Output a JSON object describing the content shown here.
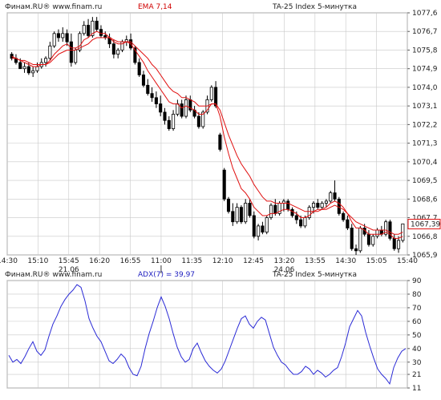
{
  "main_panel": {
    "header_left": "Финам.RU® www.finam.ru",
    "header_indicator": "EMA 7,14",
    "header_right": "TA-25 Index 5-минутка",
    "last_price_label": "1067,39"
  },
  "adx_panel": {
    "header_left": "Финам.RU® www.finam.ru",
    "header_indicator": "ADX(7) = 39,97",
    "header_right": "TA-25 Index 5-минутка"
  },
  "time_axis": {
    "ticks": [
      "14:30",
      "15:10",
      "15:45",
      "16:20",
      "16:55",
      "11:00",
      "11:35",
      "12:10",
      "12:45",
      "13:20",
      "13:55",
      "14:30",
      "15:05",
      "15:40"
    ],
    "date_labels": [
      {
        "label": "21.06",
        "at_tick": 2
      },
      {
        "label": "24.06",
        "at_tick": 9
      }
    ],
    "session_break_at_tick": 5
  },
  "colors": {
    "bull_candle": "#ffffff",
    "bear_candle": "#000000",
    "ema": "#e01010",
    "adx": "#2b2bd6",
    "grid": "#c8c8c8",
    "indicator_label": "#d00000",
    "adx_label": "#2020c0"
  },
  "chart_data": [
    {
      "type": "candlestick",
      "title": "TA-25 Index 5-минутка",
      "indicator": "EMA 7,14",
      "y_axis_ticks": [
        "1077,6",
        "1076,7",
        "1075,8",
        "1074,9",
        "1074,0",
        "1073,1",
        "1072,2",
        "1071,3",
        "1070,4",
        "1069,5",
        "1068,6",
        "1067,7",
        "1066,8",
        "1065,9"
      ],
      "ylim": [
        1065.9,
        1077.6
      ],
      "grid": true,
      "last_price": 1067.39,
      "candles": [
        [
          1075.6,
          1075.7,
          1075.3,
          1075.4
        ],
        [
          1075.4,
          1075.6,
          1075.1,
          1075.2
        ],
        [
          1075.2,
          1075.4,
          1074.9,
          1074.9
        ],
        [
          1074.9,
          1075.2,
          1074.7,
          1075.0
        ],
        [
          1075.0,
          1075.2,
          1074.6,
          1074.7
        ],
        [
          1074.7,
          1075.0,
          1074.5,
          1074.8
        ],
        [
          1074.8,
          1075.2,
          1074.7,
          1075.0
        ],
        [
          1075.0,
          1075.4,
          1074.9,
          1075.2
        ],
        [
          1075.2,
          1075.5,
          1075.0,
          1075.4
        ],
        [
          1075.4,
          1076.2,
          1075.3,
          1076.0
        ],
        [
          1076.0,
          1076.7,
          1075.9,
          1076.6
        ],
        [
          1076.6,
          1076.8,
          1076.2,
          1076.4
        ],
        [
          1076.4,
          1076.9,
          1076.2,
          1076.6
        ],
        [
          1076.6,
          1076.8,
          1076.0,
          1076.2
        ],
        [
          1076.2,
          1076.6,
          1075.0,
          1075.2
        ],
        [
          1075.2,
          1075.9,
          1075.1,
          1075.8
        ],
        [
          1075.8,
          1076.7,
          1075.7,
          1076.6
        ],
        [
          1076.6,
          1077.2,
          1076.5,
          1077.0
        ],
        [
          1077.0,
          1077.3,
          1076.4,
          1076.5
        ],
        [
          1076.5,
          1077.4,
          1076.4,
          1077.2
        ],
        [
          1077.2,
          1077.4,
          1076.7,
          1076.8
        ],
        [
          1076.8,
          1077.0,
          1076.4,
          1076.5
        ],
        [
          1076.5,
          1076.7,
          1076.3,
          1076.4
        ],
        [
          1076.4,
          1076.6,
          1075.9,
          1076.1
        ],
        [
          1076.1,
          1076.3,
          1075.4,
          1075.6
        ],
        [
          1075.6,
          1075.9,
          1075.4,
          1075.8
        ],
        [
          1075.8,
          1076.3,
          1075.7,
          1076.2
        ],
        [
          1076.2,
          1076.5,
          1076.0,
          1076.3
        ],
        [
          1076.3,
          1076.6,
          1075.8,
          1075.9
        ],
        [
          1075.9,
          1076.0,
          1075.1,
          1075.2
        ],
        [
          1075.2,
          1075.4,
          1074.5,
          1074.6
        ],
        [
          1074.6,
          1074.8,
          1074.0,
          1074.1
        ],
        [
          1074.1,
          1074.4,
          1073.6,
          1073.7
        ],
        [
          1073.7,
          1074.0,
          1073.3,
          1073.5
        ],
        [
          1073.5,
          1073.8,
          1073.0,
          1073.2
        ],
        [
          1073.2,
          1073.6,
          1072.6,
          1072.8
        ],
        [
          1072.8,
          1073.0,
          1072.2,
          1072.4
        ],
        [
          1072.4,
          1072.6,
          1071.9,
          1072.0
        ],
        [
          1072.0,
          1072.9,
          1071.9,
          1072.7
        ],
        [
          1072.7,
          1073.4,
          1072.6,
          1073.2
        ],
        [
          1073.2,
          1073.4,
          1072.5,
          1072.6
        ],
        [
          1072.6,
          1073.6,
          1072.5,
          1073.4
        ],
        [
          1073.4,
          1073.6,
          1072.8,
          1072.9
        ],
        [
          1072.9,
          1073.1,
          1072.5,
          1072.6
        ],
        [
          1072.6,
          1072.8,
          1072.0,
          1072.1
        ],
        [
          1072.1,
          1072.9,
          1072.0,
          1072.8
        ],
        [
          1072.8,
          1073.6,
          1072.7,
          1073.4
        ],
        [
          1073.4,
          1074.1,
          1073.3,
          1074.0
        ],
        [
          1074.0,
          1074.3,
          1073.0,
          1073.1
        ],
        [
          1071.7,
          1071.8,
          1070.9,
          1071.0
        ],
        [
          1070.0,
          1070.1,
          1068.5,
          1068.6
        ],
        [
          1068.6,
          1068.7,
          1067.9,
          1068.0
        ],
        [
          1068.0,
          1068.4,
          1067.3,
          1067.5
        ],
        [
          1067.5,
          1068.4,
          1067.4,
          1068.2
        ],
        [
          1068.2,
          1068.3,
          1067.4,
          1067.5
        ],
        [
          1067.5,
          1068.6,
          1067.4,
          1068.4
        ],
        [
          1068.4,
          1068.6,
          1067.7,
          1067.8
        ],
        [
          1067.8,
          1068.0,
          1066.7,
          1066.8
        ],
        [
          1066.8,
          1067.4,
          1066.6,
          1067.3
        ],
        [
          1067.3,
          1067.5,
          1066.9,
          1067.0
        ],
        [
          1067.0,
          1067.8,
          1066.9,
          1067.7
        ],
        [
          1067.7,
          1068.4,
          1067.6,
          1068.3
        ],
        [
          1068.3,
          1068.6,
          1067.8,
          1067.9
        ],
        [
          1067.9,
          1068.5,
          1067.8,
          1068.4
        ],
        [
          1068.4,
          1068.6,
          1068.0,
          1068.5
        ],
        [
          1068.5,
          1068.6,
          1068.0,
          1068.1
        ],
        [
          1068.1,
          1068.2,
          1067.7,
          1067.8
        ],
        [
          1067.8,
          1068.0,
          1067.4,
          1067.6
        ],
        [
          1067.6,
          1067.8,
          1067.2,
          1067.3
        ],
        [
          1067.3,
          1067.8,
          1067.2,
          1067.7
        ],
        [
          1067.7,
          1068.3,
          1067.6,
          1068.2
        ],
        [
          1068.2,
          1068.5,
          1067.9,
          1068.4
        ],
        [
          1068.4,
          1068.6,
          1068.1,
          1068.2
        ],
        [
          1068.2,
          1068.5,
          1068.1,
          1068.4
        ],
        [
          1068.4,
          1068.6,
          1068.2,
          1068.5
        ],
        [
          1068.5,
          1069.0,
          1068.4,
          1068.9
        ],
        [
          1068.9,
          1069.5,
          1068.5,
          1068.6
        ],
        [
          1068.6,
          1068.7,
          1067.8,
          1067.9
        ],
        [
          1067.9,
          1068.0,
          1067.5,
          1067.6
        ],
        [
          1067.6,
          1067.8,
          1067.1,
          1067.2
        ],
        [
          1067.2,
          1067.4,
          1066.1,
          1066.2
        ],
        [
          1066.2,
          1066.4,
          1065.9,
          1066.1
        ],
        [
          1066.1,
          1067.3,
          1066.0,
          1067.2
        ],
        [
          1067.2,
          1067.4,
          1066.8,
          1066.9
        ],
        [
          1066.9,
          1067.1,
          1066.3,
          1066.4
        ],
        [
          1066.4,
          1066.9,
          1066.3,
          1066.8
        ],
        [
          1066.8,
          1067.2,
          1066.7,
          1067.1
        ],
        [
          1067.1,
          1067.3,
          1066.8,
          1066.9
        ],
        [
          1066.9,
          1067.6,
          1066.8,
          1067.5
        ],
        [
          1067.5,
          1067.6,
          1066.6,
          1066.7
        ],
        [
          1066.7,
          1066.9,
          1066.1,
          1066.2
        ],
        [
          1066.2,
          1066.8,
          1066.0,
          1066.6
        ],
        [
          1066.6,
          1067.4,
          1066.5,
          1067.4
        ]
      ],
      "ema_fast": [
        1075.5,
        1075.4,
        1075.3,
        1075.2,
        1075.1,
        1075.0,
        1075.0,
        1075.1,
        1075.1,
        1075.3,
        1075.6,
        1075.8,
        1076.0,
        1076.1,
        1075.9,
        1075.9,
        1076.0,
        1076.3,
        1076.4,
        1076.6,
        1076.7,
        1076.6,
        1076.6,
        1076.4,
        1076.2,
        1076.1,
        1076.1,
        1076.2,
        1076.1,
        1075.8,
        1075.5,
        1075.2,
        1074.8,
        1074.5,
        1074.2,
        1073.9,
        1073.6,
        1073.3,
        1073.2,
        1073.2,
        1073.0,
        1073.1,
        1073.0,
        1072.9,
        1072.7,
        1072.7,
        1072.9,
        1073.2,
        1073.2,
        1072.6,
        1071.6,
        1070.8,
        1070.1,
        1069.6,
        1069.1,
        1068.9,
        1068.6,
        1068.2,
        1068.0,
        1067.8,
        1067.8,
        1067.9,
        1067.9,
        1068.0,
        1068.1,
        1068.1,
        1068.0,
        1067.9,
        1067.7,
        1067.7,
        1067.8,
        1068.0,
        1068.0,
        1068.1,
        1068.2,
        1068.4,
        1068.5,
        1068.4,
        1068.2,
        1067.9,
        1067.5,
        1067.2,
        1067.2,
        1067.1,
        1066.9,
        1066.9,
        1066.9,
        1066.9,
        1067.0,
        1066.9,
        1066.7,
        1066.7,
        1066.8
      ],
      "ema_slow": [
        1075.4,
        1075.4,
        1075.3,
        1075.3,
        1075.2,
        1075.1,
        1075.1,
        1075.1,
        1075.1,
        1075.2,
        1075.4,
        1075.6,
        1075.7,
        1075.8,
        1075.8,
        1075.8,
        1075.9,
        1076.0,
        1076.1,
        1076.3,
        1076.4,
        1076.4,
        1076.4,
        1076.4,
        1076.3,
        1076.2,
        1076.2,
        1076.2,
        1076.2,
        1076.0,
        1075.8,
        1075.6,
        1075.4,
        1075.1,
        1074.9,
        1074.6,
        1074.3,
        1074.0,
        1073.8,
        1073.7,
        1073.5,
        1073.5,
        1073.4,
        1073.3,
        1073.1,
        1073.1,
        1073.1,
        1073.2,
        1073.2,
        1072.9,
        1072.3,
        1071.7,
        1071.2,
        1070.7,
        1070.3,
        1070.0,
        1069.7,
        1069.3,
        1069.0,
        1068.7,
        1068.5,
        1068.5,
        1068.4,
        1068.4,
        1068.4,
        1068.4,
        1068.3,
        1068.2,
        1068.1,
        1068.0,
        1068.0,
        1068.0,
        1068.1,
        1068.1,
        1068.1,
        1068.2,
        1068.3,
        1068.2,
        1068.1,
        1067.9,
        1067.7,
        1067.5,
        1067.4,
        1067.3,
        1067.2,
        1067.1,
        1067.1,
        1067.1,
        1067.1,
        1067.0,
        1066.9,
        1066.9,
        1067.0
      ]
    },
    {
      "type": "line",
      "title": "TA-25 Index 5-минутка",
      "indicator": "ADX(7)",
      "last_value": 39.97,
      "y_axis_ticks": [
        "90",
        "80",
        "70",
        "60",
        "50",
        "40",
        "30",
        "21",
        "11"
      ],
      "ylim": [
        11,
        90
      ],
      "grid": true,
      "series": [
        {
          "name": "ADX(7)",
          "values": [
            35,
            30,
            32,
            29,
            34,
            40,
            45,
            38,
            35,
            39,
            49,
            58,
            64,
            71,
            76,
            80,
            83,
            87,
            85,
            75,
            62,
            55,
            49,
            45,
            38,
            31,
            29,
            32,
            36,
            33,
            26,
            21,
            20,
            27,
            40,
            51,
            60,
            70,
            78,
            71,
            62,
            51,
            41,
            34,
            30,
            32,
            40,
            44,
            37,
            31,
            27,
            24,
            22,
            25,
            31,
            39,
            47,
            55,
            62,
            64,
            58,
            55,
            60,
            63,
            61,
            51,
            41,
            35,
            30,
            28,
            24,
            21,
            21,
            23,
            27,
            25,
            21,
            24,
            22,
            19,
            21,
            24,
            26,
            34,
            44,
            56,
            62,
            68,
            64,
            52,
            42,
            33,
            25,
            21,
            18,
            14,
            26,
            33,
            38,
            40
          ]
        }
      ]
    }
  ]
}
